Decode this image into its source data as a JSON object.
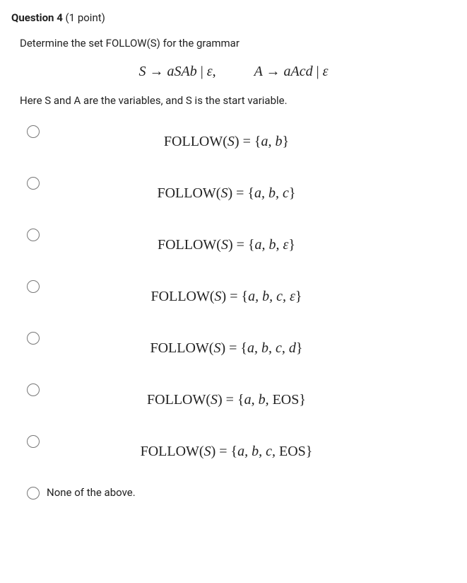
{
  "question": {
    "number_label": "Question 4",
    "points": "(1 point)",
    "prompt": "Determine the set FOLLOW(S) for the grammar",
    "grammar_part1_lhs": "S",
    "grammar_arrow": "→",
    "grammar_part1_rhs": "aSAb",
    "grammar_bar": " | ",
    "grammar_eps": "ε",
    "grammar_comma": ",",
    "grammar_part2_lhs": "A",
    "grammar_part2_rhs": "aAcd",
    "note": "Here S and A are the variables, and S is the start variable."
  },
  "options": [
    {
      "prefix": "FOLLOW(",
      "var": "S",
      "suffix": ") = {",
      "set_it": "a, b",
      "close": "}"
    },
    {
      "prefix": "FOLLOW(",
      "var": "S",
      "suffix": ") = {",
      "set_it": "a, b, c",
      "close": "}"
    },
    {
      "prefix": "FOLLOW(",
      "var": "S",
      "suffix": ") = {",
      "set_it": "a, b, ε",
      "close": "}"
    },
    {
      "prefix": "FOLLOW(",
      "var": "S",
      "suffix": ") = {",
      "set_it": "a, b, c, ε",
      "close": "}"
    },
    {
      "prefix": "FOLLOW(",
      "var": "S",
      "suffix": ") = {",
      "set_it": "a, b, c, d",
      "close": "}"
    },
    {
      "prefix": "FOLLOW(",
      "var": "S",
      "suffix": ") = {",
      "set_it": "a, b, ",
      "set_rm": "EOS",
      "close": "}"
    },
    {
      "prefix": "FOLLOW(",
      "var": "S",
      "suffix": ") = {",
      "set_it": "a, b, c, ",
      "set_rm": "EOS",
      "close": "}"
    }
  ],
  "none_label": "None of the above."
}
